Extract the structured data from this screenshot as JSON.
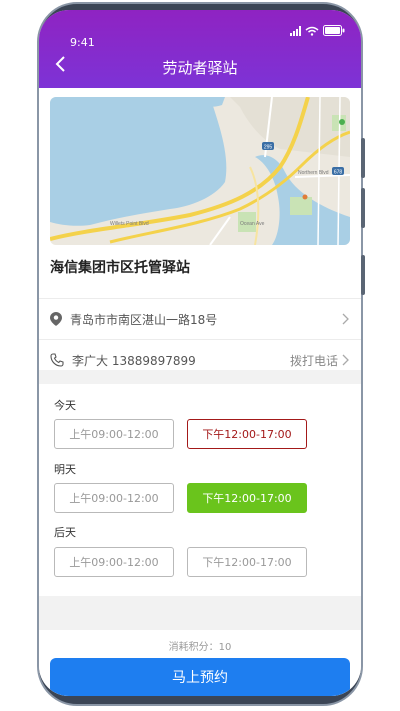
{
  "status": {
    "time": "9:41"
  },
  "header": {
    "title": "劳动者驿站"
  },
  "station": {
    "name": "海信集团市区托管驿站",
    "address": "青岛市市南区湛山一路18号",
    "contact": "李广大 13889897899",
    "call_label": "拨打电话"
  },
  "map_labels": {
    "road1": "Northern Blvd",
    "road2": "Ocean Ave",
    "road3": "Willets Point Blvd",
    "highway1": "295",
    "highway2": "678"
  },
  "schedule": {
    "days": [
      {
        "label": "今天",
        "morning": "上午09:00-12:00",
        "afternoon": "下午12:00-17:00"
      },
      {
        "label": "明天",
        "morning": "上午09:00-12:00",
        "afternoon": "下午12:00-17:00"
      },
      {
        "label": "后天",
        "morning": "上午09:00-12:00",
        "afternoon": "下午12:00-17:00"
      }
    ]
  },
  "footer": {
    "points": "消耗积分：10",
    "reserve_label": "马上预约"
  },
  "colors": {
    "header_gradient_start": "#8f23c2",
    "header_gradient_end": "#7d33d6",
    "selected_red": "#a31919",
    "selected_green": "#6ac41c",
    "primary_button": "#1e7ef0"
  }
}
